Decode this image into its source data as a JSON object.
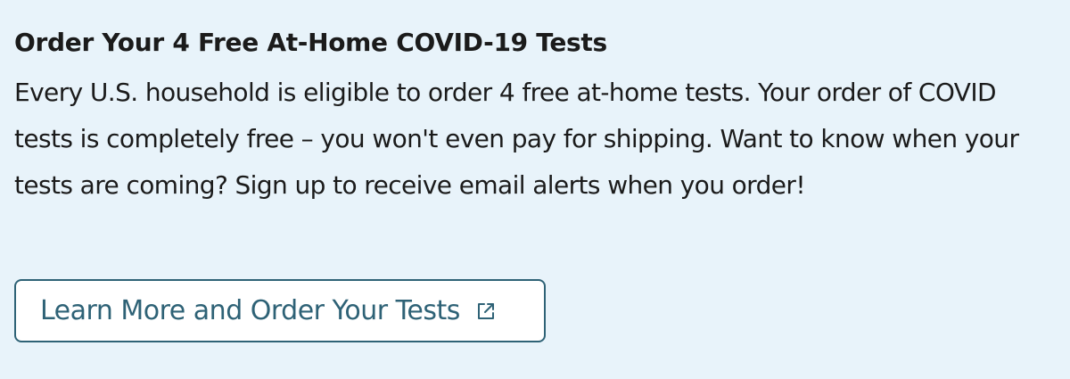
{
  "card": {
    "title": "Order Your 4 Free At-Home COVID-19 Tests",
    "body": "Every U.S. household is eligible to order 4 free at-home tests. Your order of COVID tests is completely free – you won't even pay for shipping. Want to know when your tests are coming? Sign up to receive email alerts when you order!",
    "button_label": "Learn More and Order Your Tests",
    "button_icon": "external-link-icon"
  },
  "colors": {
    "background": "#e8f3fa",
    "text": "#1b1b1b",
    "accent": "#2e6276",
    "button_background": "#ffffff"
  }
}
